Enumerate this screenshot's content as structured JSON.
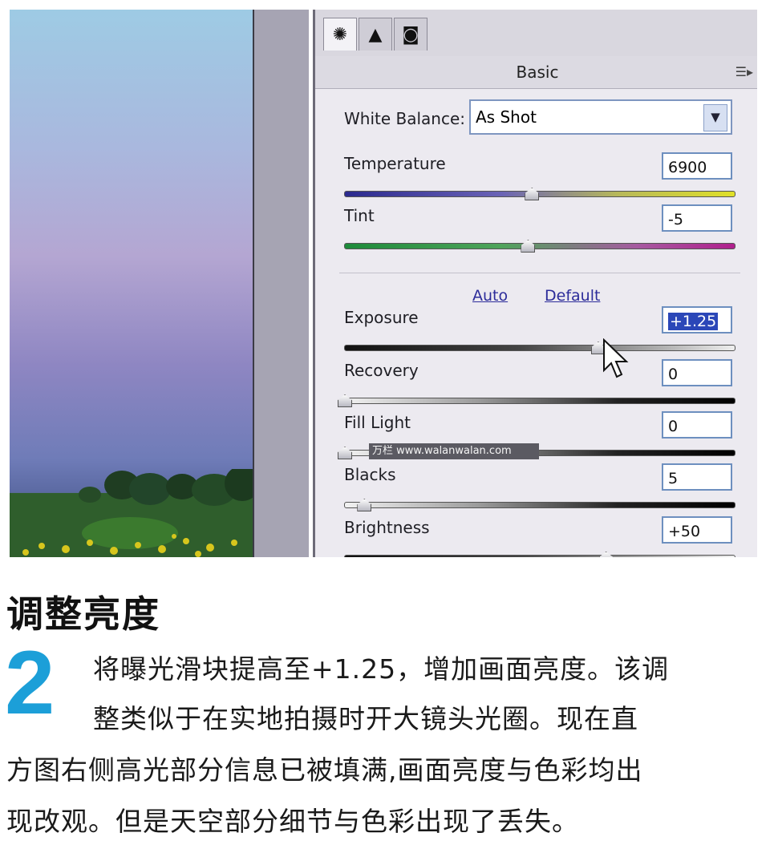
{
  "panel": {
    "section_title": "Basic",
    "menu_icon": "panel-menu-icon",
    "tabs": [
      {
        "icon": "aperture-icon"
      },
      {
        "icon": "mountain-icon"
      },
      {
        "icon": "camera-icon"
      }
    ],
    "white_balance": {
      "label": "White Balance:",
      "value": "As Shot"
    },
    "links": {
      "auto": "Auto",
      "default": "Default"
    },
    "sliders": [
      {
        "label": "Temperature",
        "value": "6900",
        "level": 0.48,
        "track": "temperature"
      },
      {
        "label": "Tint",
        "value": "-5",
        "level": 0.47,
        "track": "tint"
      },
      {
        "label": "Exposure",
        "value": "+1.25",
        "level": 0.65,
        "track": "dark",
        "selected": true
      },
      {
        "label": "Recovery",
        "value": "0",
        "level": 0.0,
        "track": "dark-right"
      },
      {
        "label": "Fill Light",
        "value": "0",
        "level": 0.0,
        "track": "dark-right"
      },
      {
        "label": "Blacks",
        "value": "5",
        "level": 0.05,
        "track": "dark-right"
      },
      {
        "label": "Brightness",
        "value": "+50",
        "level": 0.67,
        "track": "dark"
      }
    ]
  },
  "watermark": "万栏 www.walanwalan.com",
  "article": {
    "heading": "调整亮度",
    "step_number": "2",
    "lines": [
      "将曝光滑块提高至+1.25，增加画面亮度。该调",
      "整类似于在实地拍摄时开大镜头光圈。现在直",
      "方图右侧高光部分信息已被填满,画面亮度与色彩均出",
      "现改观。但是天空部分细节与色彩出现了丢失。"
    ]
  }
}
